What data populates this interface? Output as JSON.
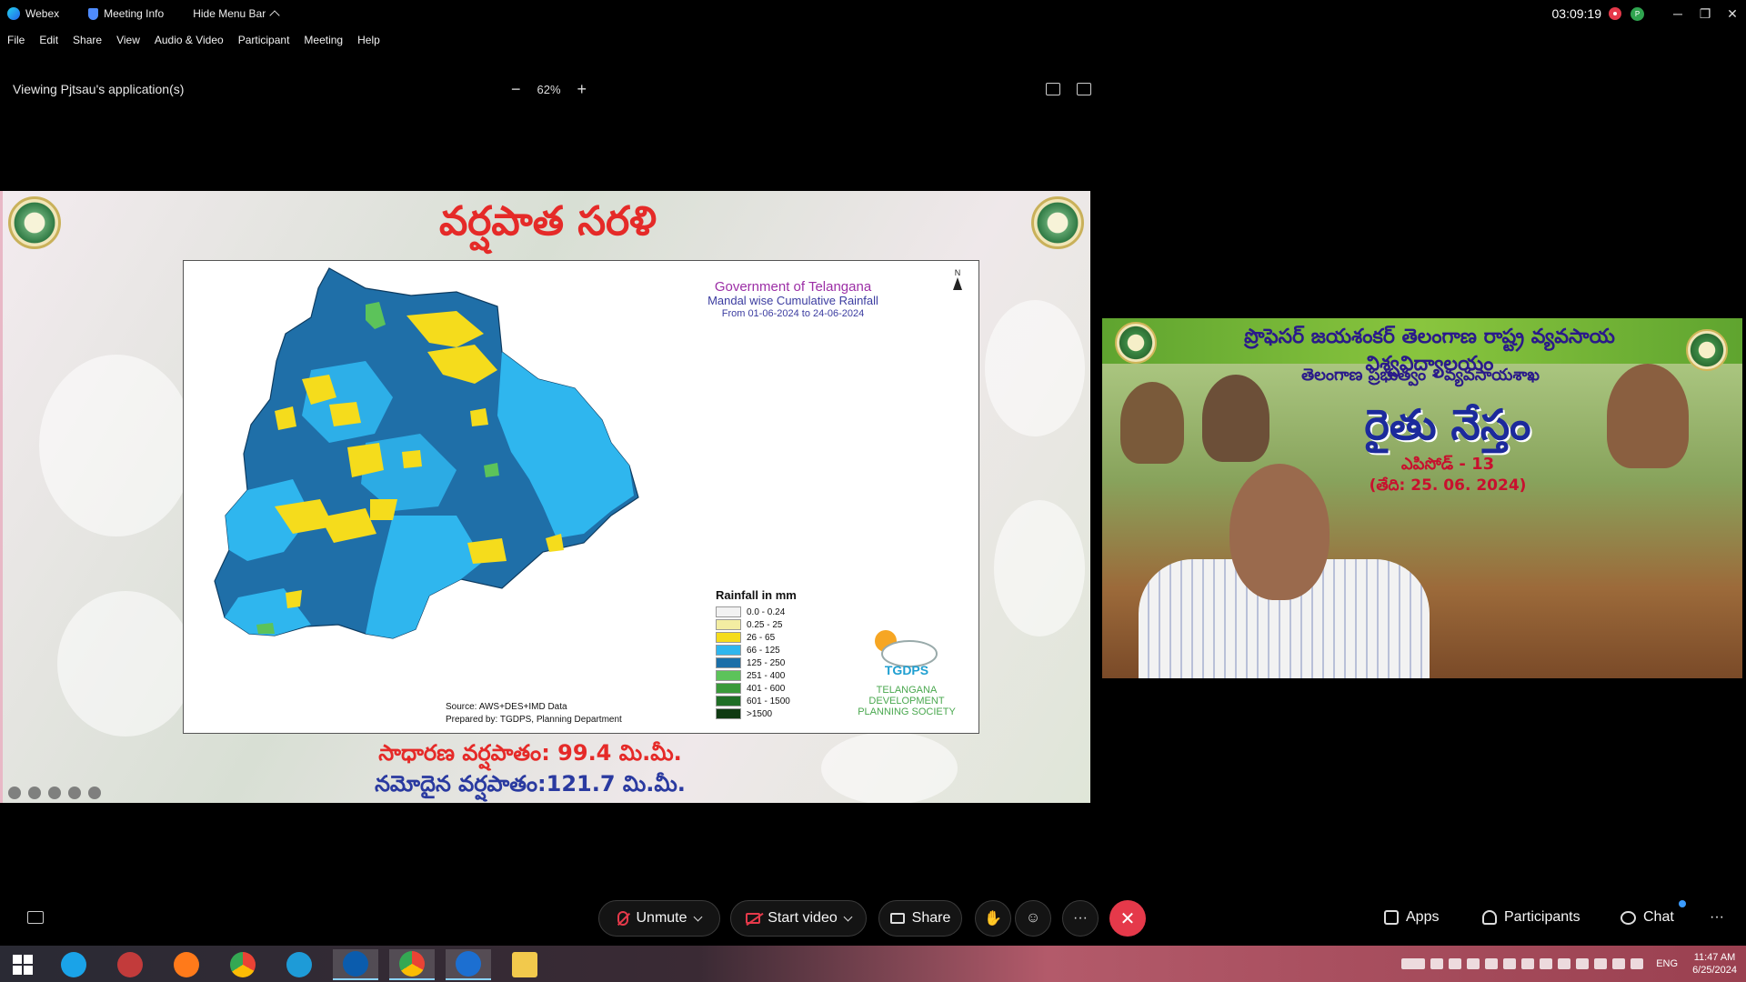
{
  "titlebar": {
    "app_name": "Webex",
    "meeting_info": "Meeting Info",
    "hide_menu": "Hide Menu Bar",
    "timer": "03:09:19",
    "avatar_initials": "P",
    "win_minimize": "─",
    "win_restore": "❐",
    "win_close": "✕"
  },
  "menu": [
    "File",
    "Edit",
    "Share",
    "View",
    "Audio & Video",
    "Participant",
    "Meeting",
    "Help"
  ],
  "viewing": {
    "title": "Viewing Pjtsau's application(s)",
    "zoom_minus": "−",
    "zoom_level": "62%",
    "zoom_plus": "+"
  },
  "slide": {
    "title": "వర్షపాత సరళి",
    "map_header": {
      "line1": "Government of Telangana",
      "line2": "Mandal wise Cumulative Rainfall",
      "line3": "From 01-06-2024 to 24-06-2024"
    },
    "north_label": "N",
    "legend": {
      "title": "Rainfall in mm",
      "items": [
        {
          "label": "0.0 - 0.24",
          "color": "#f2f2f2"
        },
        {
          "label": "0.25 - 25",
          "color": "#f3eda2"
        },
        {
          "label": "26 - 65",
          "color": "#f5dc1c"
        },
        {
          "label": "66 - 125",
          "color": "#2fb6ee"
        },
        {
          "label": "125 - 250",
          "color": "#1b6fa8"
        },
        {
          "label": "251 - 400",
          "color": "#5cc35a"
        },
        {
          "label": "401 - 600",
          "color": "#3a9a3a"
        },
        {
          "label": "601 - 1500",
          "color": "#1f6e26"
        },
        {
          "label": ">1500",
          "color": "#0f3a12"
        }
      ]
    },
    "source_line1": "Source: AWS+DES+IMD Data",
    "source_line2": "Prepared by: TGDPS, Planning Department",
    "tgdps_title": "TGDPS",
    "tgdps_sub1": "TELANGANA",
    "tgdps_sub2": "DEVELOPMENT",
    "tgdps_sub3": "PLANNING SOCIETY",
    "normal_rainfall": "సాధారణ వర్షపాతం: 99.4 మి.మీ.",
    "recorded_rainfall": "నమోదైన వర్షపాతం:121.7 మి.మీ."
  },
  "video": {
    "banner": "ప్రొఫెసర్ జయశంకర్ తెలంగాణ రాష్ట్ర వ్యవసాయ విశ్వవిద్యాలయం",
    "department": "తెలంగాణ ప్రభుత్వం - వ్యవసాయశాఖ",
    "show_title": "రైతు నేస్తం",
    "episode": "ఎపిసోడ్ - 13",
    "date": "(తేది: 25. 06. 2024)"
  },
  "controls": {
    "unmute": "Unmute",
    "start_video": "Start video",
    "share": "Share",
    "more": "···",
    "apps": "Apps",
    "participants": "Participants",
    "chat": "Chat",
    "overflow": "···"
  },
  "taskbar": {
    "lang": "ENG",
    "time": "11:47 AM",
    "date": "6/25/2024"
  }
}
